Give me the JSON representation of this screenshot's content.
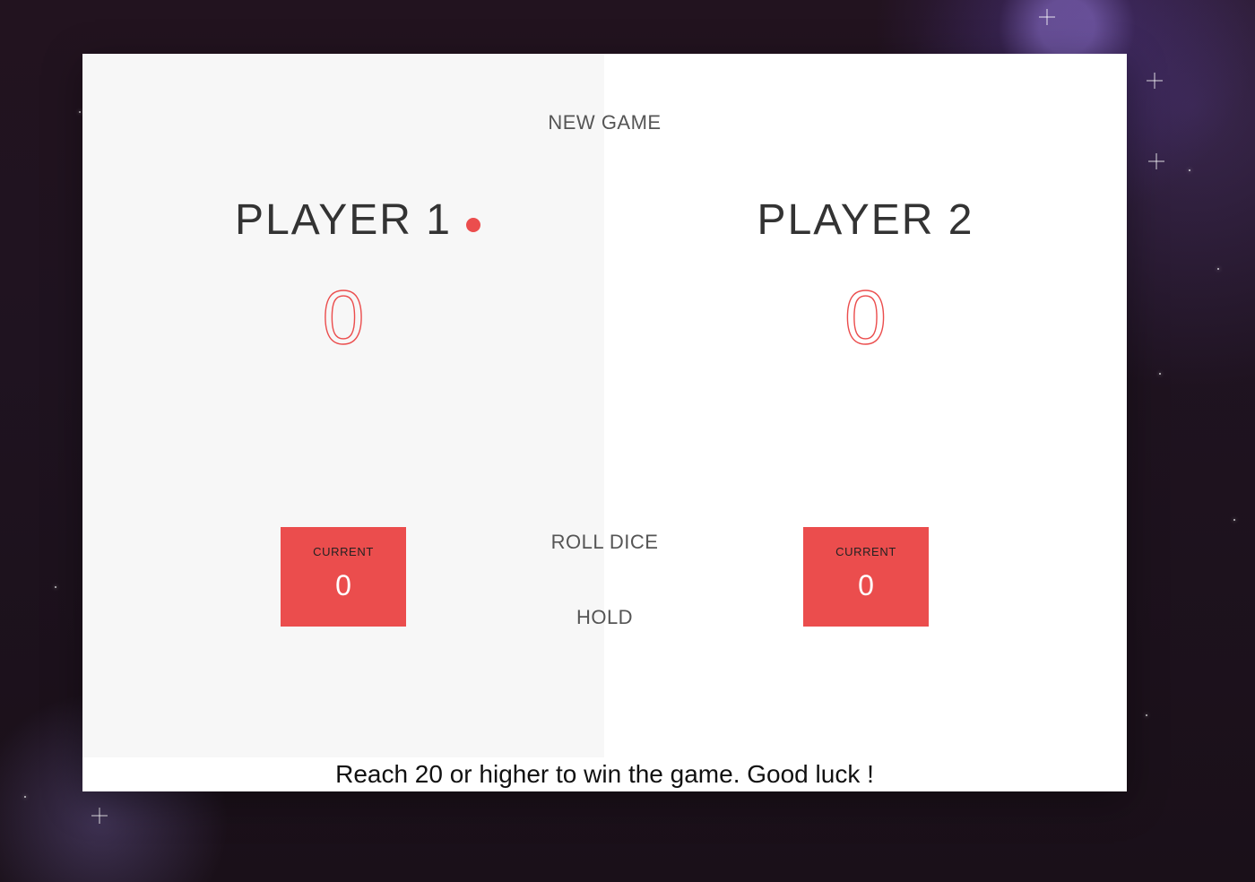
{
  "controls": {
    "new_game_label": "NEW GAME",
    "roll_dice_label": "ROLL DICE",
    "hold_label": "HOLD"
  },
  "players": [
    {
      "name": "PLAYER 1",
      "score": "0",
      "current_label": "CURRENT",
      "current_score": "0",
      "active": true
    },
    {
      "name": "PLAYER 2",
      "score": "0",
      "current_label": "CURRENT",
      "current_score": "0",
      "active": false
    }
  ],
  "footer": {
    "message": "Reach 20 or higher to win the game. Good luck !"
  },
  "colors": {
    "accent": "#eb4d4d",
    "panel_left_bg": "#f7f7f7",
    "panel_right_bg": "#ffffff"
  }
}
